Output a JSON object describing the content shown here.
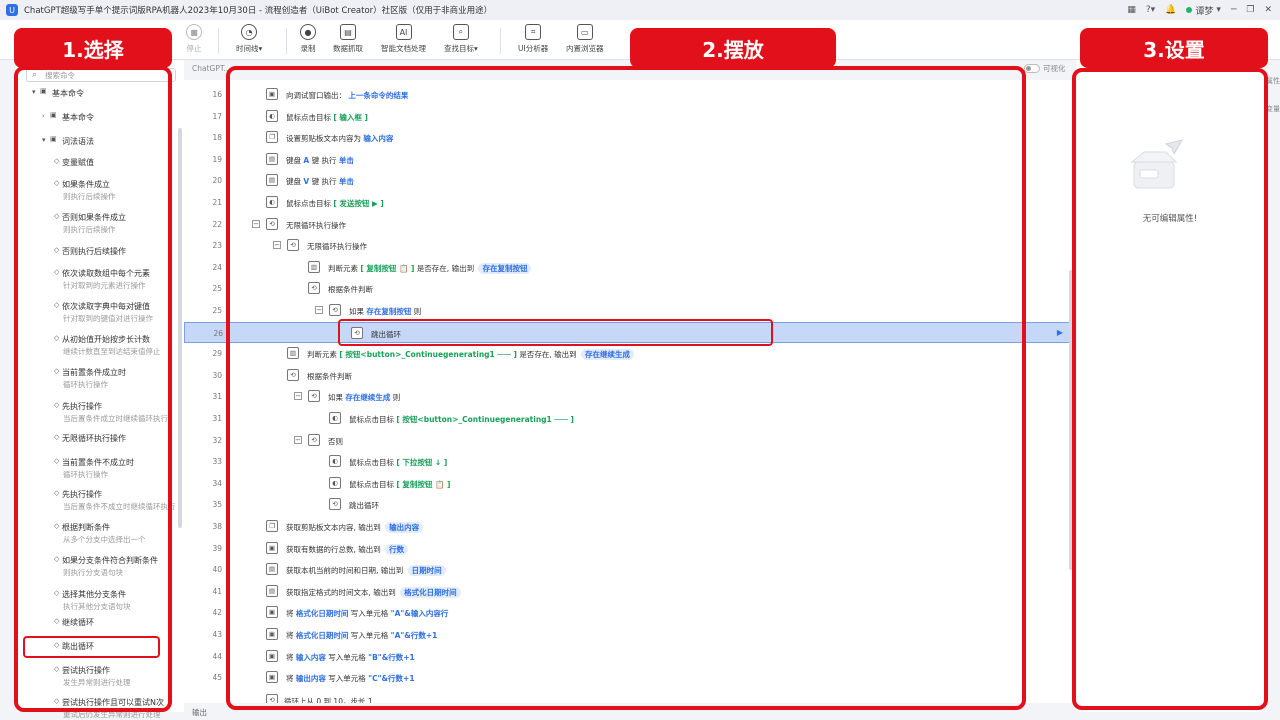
{
  "window": {
    "title": "ChatGPT超级写手单个提示词版RPA机器人2023年10月30日 - 流程创造者（UiBot Creator）社区版（仅用于非商业用途）",
    "user": "谭梦",
    "icons": [
      "grid-icon",
      "help-icon",
      "bell-icon",
      "user-dot-icon",
      "minimize-icon",
      "restore-icon",
      "close-icon"
    ]
  },
  "toolbar": {
    "items": [
      {
        "label": "停止",
        "icon": "stop-icon"
      },
      {
        "label": "时间线",
        "icon": "clock-icon"
      },
      {
        "label": "录制",
        "icon": "record-icon"
      },
      {
        "label": "数据抓取",
        "icon": "scrape-icon"
      },
      {
        "label": "智能文档处理",
        "icon": "doc-ai-icon"
      },
      {
        "label": "查找目标",
        "icon": "find-target-icon"
      },
      {
        "label": "UI分析器",
        "icon": "ui-analyzer-icon"
      },
      {
        "label": "内置浏览器",
        "icon": "browser-icon"
      }
    ]
  },
  "left_panel": {
    "search_placeholder": "搜索命令",
    "tree": [
      {
        "label": "基本命令"
      },
      {
        "label": "基本命令"
      },
      {
        "label": "词法语法"
      }
    ],
    "commands": [
      {
        "label": "变量赋值",
        "sub": ""
      },
      {
        "label": "如果条件成立",
        "sub": "则执行后续操作"
      },
      {
        "label": "否则如果条件成立",
        "sub": "则执行后续操作"
      },
      {
        "label": "否则执行后续操作",
        "sub": ""
      },
      {
        "label": "依次读取数组中每个元素",
        "sub": "针对取到的元素进行操作"
      },
      {
        "label": "依次读取字典中每对键值",
        "sub": "针对取到的键值对进行操作"
      },
      {
        "label": "从初始值开始按步长计数",
        "sub": "继续计数直至到达结束值停止"
      },
      {
        "label": "当前置条件成立时",
        "sub": "循环执行操作"
      },
      {
        "label": "先执行操作",
        "sub": "当后置条件成立时继续循环执行"
      },
      {
        "label": "无限循环执行操作",
        "sub": ""
      },
      {
        "label": "当前置条件不成立时",
        "sub": "循环执行操作"
      },
      {
        "label": "先执行操作",
        "sub": "当后置条件不成立时继续循环执行"
      },
      {
        "label": "根据判断条件",
        "sub": "从多个分支中选择出一个"
      },
      {
        "label": "如果分支条件符合判断条件",
        "sub": "则执行分支语句块"
      },
      {
        "label": "选择其他分支条件",
        "sub": "执行其他分支语句块"
      },
      {
        "label": "继续循环",
        "sub": ""
      },
      {
        "label": "跳出循环",
        "sub": ""
      },
      {
        "label": "尝试执行操作",
        "sub": "发生异常则进行处理"
      },
      {
        "label": "尝试执行操作且可以重试N次",
        "sub": "重试后仍发生异常则进行处理"
      }
    ]
  },
  "editor": {
    "tab": "ChatGPT...",
    "visual_toggle": "可视化",
    "output_label": "输出",
    "rows": [
      {
        "n": "16",
        "parts": [
          [
            "t",
            "向调试窗口输出："
          ],
          [
            "k",
            "上一条命令的结果"
          ]
        ]
      },
      {
        "n": "17",
        "parts": [
          [
            "t",
            "鼠标点击目标"
          ],
          [
            "g",
            "[ 输入框        ]"
          ]
        ]
      },
      {
        "n": "18",
        "parts": [
          [
            "t",
            "设置剪贴板文本内容为"
          ],
          [
            "k",
            "输入内容"
          ]
        ]
      },
      {
        "n": "19",
        "parts": [
          [
            "t",
            "键盘"
          ],
          [
            "k",
            "A"
          ],
          [
            "t",
            "键 执行"
          ],
          [
            "k",
            "单击"
          ]
        ]
      },
      {
        "n": "20",
        "parts": [
          [
            "t",
            "键盘"
          ],
          [
            "k",
            "V"
          ],
          [
            "t",
            "键 执行"
          ],
          [
            "k",
            "单击"
          ]
        ]
      },
      {
        "n": "21",
        "parts": [
          [
            "t",
            "鼠标点击目标"
          ],
          [
            "g",
            "[ 发送按钮   ▶   ]"
          ]
        ]
      },
      {
        "n": "22",
        "parts": [
          [
            "t",
            "无限循环执行操作"
          ]
        ]
      },
      {
        "n": "23",
        "parts": [
          [
            "t",
            "无限循环执行操作"
          ]
        ]
      },
      {
        "n": "24",
        "parts": [
          [
            "t",
            "判断元素"
          ],
          [
            "g",
            "[ 复制按钮  📋  ]"
          ],
          [
            "t",
            "是否存在, 输出到"
          ],
          [
            "p",
            "存在复制按钮"
          ]
        ]
      },
      {
        "n": "25",
        "parts": [
          [
            "t",
            "根据条件判断"
          ]
        ]
      },
      {
        "n": "25",
        "parts": [
          [
            "t",
            "如果"
          ],
          [
            "k",
            "存在复制按钮"
          ],
          [
            "t",
            "则"
          ]
        ]
      },
      {
        "n": "26",
        "parts": [
          [
            "t",
            "跳出循环"
          ]
        ]
      },
      {
        "n": "29",
        "parts": [
          [
            "t",
            "判断元素"
          ],
          [
            "g",
            "[ 按钮<button>_Continuegenerating1 ─── ]"
          ],
          [
            "t",
            "是否存在, 输出到"
          ],
          [
            "p",
            "存在继续生成"
          ]
        ]
      },
      {
        "n": "30",
        "parts": [
          [
            "t",
            "根据条件判断"
          ]
        ]
      },
      {
        "n": "31",
        "parts": [
          [
            "t",
            "如果"
          ],
          [
            "k",
            "存在继续生成"
          ],
          [
            "t",
            "则"
          ]
        ]
      },
      {
        "n": "31",
        "parts": [
          [
            "t",
            "鼠标点击目标"
          ],
          [
            "g",
            "[ 按钮<button>_Continuegenerating1 ─── ]"
          ]
        ]
      },
      {
        "n": "32",
        "parts": [
          [
            "t",
            "否则"
          ]
        ]
      },
      {
        "n": "33",
        "parts": [
          [
            "t",
            "鼠标点击目标"
          ],
          [
            "g",
            "[ 下拉按钮   ↓   ]"
          ]
        ]
      },
      {
        "n": "34",
        "parts": [
          [
            "t",
            "鼠标点击目标"
          ],
          [
            "g",
            "[ 复制按钮   📋   ]"
          ]
        ]
      },
      {
        "n": "35",
        "parts": [
          [
            "t",
            "跳出循环"
          ]
        ]
      },
      {
        "n": "38",
        "parts": [
          [
            "t",
            "获取剪贴板文本内容, 输出到"
          ],
          [
            "p",
            "输出内容"
          ]
        ]
      },
      {
        "n": "39",
        "parts": [
          [
            "t",
            "获取有数据的行总数, 输出到"
          ],
          [
            "p",
            "行数"
          ]
        ]
      },
      {
        "n": "40",
        "parts": [
          [
            "t",
            "获取本机当前的时间和日期, 输出到"
          ],
          [
            "p",
            "日期时间"
          ]
        ]
      },
      {
        "n": "41",
        "parts": [
          [
            "t",
            "获取指定格式的时间文本, 输出到"
          ],
          [
            "p",
            "格式化日期时间"
          ]
        ]
      },
      {
        "n": "42",
        "parts": [
          [
            "t",
            "将"
          ],
          [
            "k",
            "格式化日期时间"
          ],
          [
            "t",
            "写入单元格"
          ],
          [
            "k",
            "\"A\"&输入内容行"
          ]
        ]
      },
      {
        "n": "43",
        "parts": [
          [
            "t",
            "将"
          ],
          [
            "k",
            "格式化日期时间"
          ],
          [
            "t",
            "写入单元格"
          ],
          [
            "k",
            "\"A\"&行数+1"
          ]
        ]
      },
      {
        "n": "44",
        "parts": [
          [
            "t",
            "将"
          ],
          [
            "k",
            "输入内容"
          ],
          [
            "t",
            "写入单元格"
          ],
          [
            "k",
            "\"B\"&行数+1"
          ]
        ]
      },
      {
        "n": "45",
        "parts": [
          [
            "t",
            "将"
          ],
          [
            "k",
            "输出内容"
          ],
          [
            "t",
            "写入单元格"
          ],
          [
            "k",
            "\"C\"&行数+1"
          ]
        ]
      }
    ],
    "last_row": "循环上从 0 到 10，步长 1"
  },
  "right_panel": {
    "empty_text": "无可编辑属性!",
    "side_tabs": [
      "属性",
      "变量"
    ]
  },
  "overlays": {
    "label1": "1.选择",
    "label2": "2.摆放",
    "label3": "3.设置",
    "color": "#e2101b"
  },
  "colors": {
    "accent": "#2f6fe4",
    "target_green": "#18a058",
    "selected_row": "#c7d7f7"
  }
}
